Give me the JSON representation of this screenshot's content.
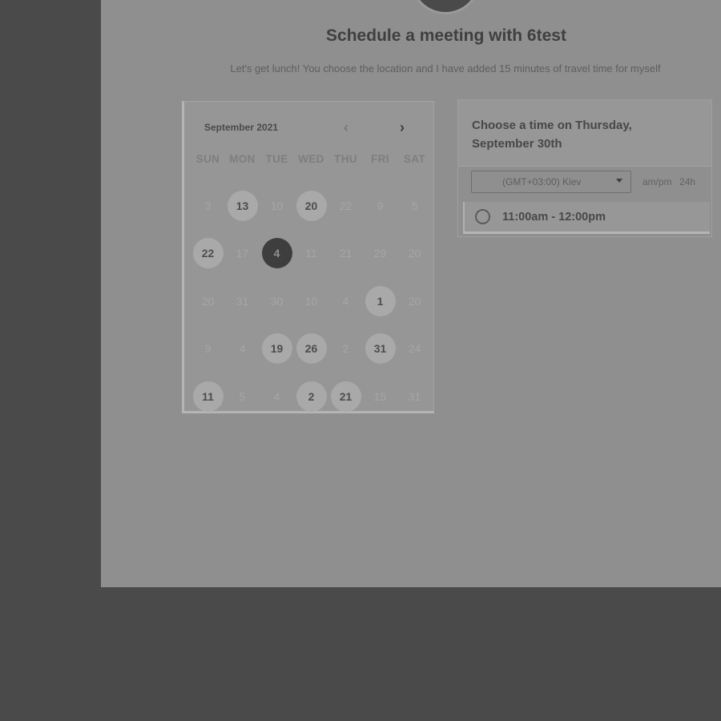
{
  "header": {
    "title": "Schedule a meeting with 6test",
    "subtitle": "Let's get lunch! You choose the location and I have added 15 minutes of travel time for myself"
  },
  "calendar": {
    "month_label": "September 2021",
    "prev_icon": "chevron-left-icon",
    "next_icon": "chevron-right-icon",
    "weekdays": [
      "SUN",
      "MON",
      "TUE",
      "WED",
      "THU",
      "FRI",
      "SAT"
    ],
    "days": [
      {
        "label": "3",
        "state": "muted"
      },
      {
        "label": "13",
        "state": "available"
      },
      {
        "label": "10",
        "state": "muted"
      },
      {
        "label": "20",
        "state": "available"
      },
      {
        "label": "22",
        "state": "muted"
      },
      {
        "label": "9",
        "state": "muted"
      },
      {
        "label": "5",
        "state": "muted"
      },
      {
        "label": "22",
        "state": "available"
      },
      {
        "label": "17",
        "state": "muted"
      },
      {
        "label": "4",
        "state": "selected"
      },
      {
        "label": "11",
        "state": "muted"
      },
      {
        "label": "21",
        "state": "muted"
      },
      {
        "label": "29",
        "state": "muted"
      },
      {
        "label": "20",
        "state": "muted"
      },
      {
        "label": "20",
        "state": "muted"
      },
      {
        "label": "31",
        "state": "muted"
      },
      {
        "label": "30",
        "state": "muted"
      },
      {
        "label": "10",
        "state": "muted"
      },
      {
        "label": "4",
        "state": "muted"
      },
      {
        "label": "1",
        "state": "available"
      },
      {
        "label": "20",
        "state": "muted"
      },
      {
        "label": "9",
        "state": "muted"
      },
      {
        "label": "4",
        "state": "muted"
      },
      {
        "label": "19",
        "state": "available"
      },
      {
        "label": "26",
        "state": "available"
      },
      {
        "label": "2",
        "state": "muted"
      },
      {
        "label": "31",
        "state": "available"
      },
      {
        "label": "24",
        "state": "muted"
      },
      {
        "label": "11",
        "state": "available"
      },
      {
        "label": "5",
        "state": "muted"
      },
      {
        "label": "4",
        "state": "muted"
      },
      {
        "label": "2",
        "state": "available"
      },
      {
        "label": "21",
        "state": "available"
      },
      {
        "label": "15",
        "state": "muted"
      },
      {
        "label": "31",
        "state": "muted"
      }
    ]
  },
  "times": {
    "title": "Choose a time on Thursday, September 30th",
    "timezone": "(GMT+03:00) Kiev",
    "format_12h": "am/pm",
    "format_24h": "24h",
    "slots": [
      {
        "label": "11:00am - 12:00pm"
      }
    ]
  }
}
